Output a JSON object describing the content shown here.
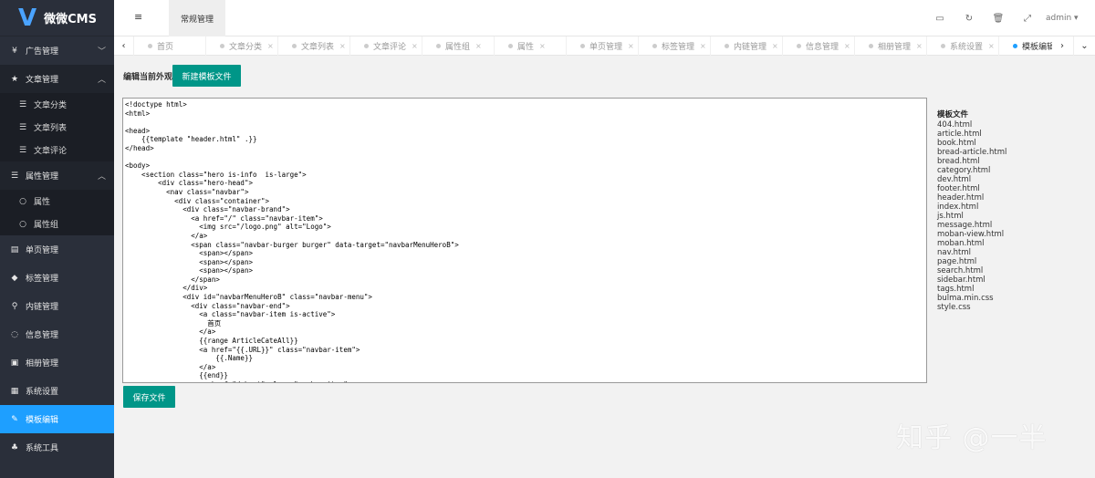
{
  "app": {
    "logo_mark": "V",
    "title": "微微CMS"
  },
  "sidebar": {
    "items": [
      {
        "label": "广告管理",
        "icon": "yen-icon",
        "glyph": "¥",
        "chevron": "﹀"
      },
      {
        "label": "文章管理",
        "icon": "star-icon",
        "glyph": "★",
        "chevron": "︿",
        "children": [
          {
            "label": "文章分类",
            "icon": "list-icon",
            "glyph": "☰"
          },
          {
            "label": "文章列表",
            "icon": "list-icon",
            "glyph": "☰"
          },
          {
            "label": "文章评论",
            "icon": "list-icon",
            "glyph": "☰"
          }
        ]
      },
      {
        "label": "属性管理",
        "icon": "list-icon",
        "glyph": "☰",
        "chevron": "︿",
        "children": [
          {
            "label": "属性",
            "icon": "circle-icon",
            "glyph": "○"
          },
          {
            "label": "属性组",
            "icon": "circle-icon",
            "glyph": "○"
          }
        ]
      },
      {
        "label": "单页管理",
        "icon": "file-icon",
        "glyph": "▤"
      },
      {
        "label": "标签管理",
        "icon": "tag-icon",
        "glyph": "◆"
      },
      {
        "label": "内链管理",
        "icon": "link-icon",
        "glyph": "⚲"
      },
      {
        "label": "信息管理",
        "icon": "comment-icon",
        "glyph": "◌"
      },
      {
        "label": "相册管理",
        "icon": "image-icon",
        "glyph": "▣"
      },
      {
        "label": "系统设置",
        "icon": "windows-icon",
        "glyph": "▦"
      },
      {
        "label": "模板编辑",
        "icon": "edit-icon",
        "glyph": "✎"
      },
      {
        "label": "系统工具",
        "icon": "sitemap-icon",
        "glyph": "♣"
      }
    ]
  },
  "header": {
    "menu_glyph": "≡",
    "tab_label": "常规管理",
    "user": "admin ▾",
    "icons": [
      {
        "name": "monitor-icon",
        "glyph": "▭"
      },
      {
        "name": "refresh-icon",
        "glyph": "↻"
      },
      {
        "name": "trash-icon",
        "glyph": "🗑"
      },
      {
        "name": "fullscreen-icon",
        "glyph": "⤢"
      }
    ]
  },
  "tabs": {
    "prev_glyph": "‹",
    "next_glyph": "›",
    "down_glyph": "⌄",
    "close_glyph": "×",
    "items": [
      {
        "label": "首页",
        "closable": false
      },
      {
        "label": "文章分类",
        "closable": true
      },
      {
        "label": "文章列表",
        "closable": true
      },
      {
        "label": "文章评论",
        "closable": true
      },
      {
        "label": "属性组",
        "closable": true
      },
      {
        "label": "属性",
        "closable": true
      },
      {
        "label": "单页管理",
        "closable": true
      },
      {
        "label": "标签管理",
        "closable": true
      },
      {
        "label": "内链管理",
        "closable": true
      },
      {
        "label": "信息管理",
        "closable": true
      },
      {
        "label": "相册管理",
        "closable": true
      },
      {
        "label": "系统设置",
        "closable": true
      },
      {
        "label": "模板编辑",
        "closable": true,
        "active": true
      }
    ]
  },
  "main": {
    "section_label": "编辑当前外观",
    "new_button": "新建模板文件",
    "save_button": "保存文件",
    "code": "<!doctype html>\n<html>\n\n<head>\n    {{template \"header.html\" .}}\n</head>\n\n<body>\n    <section class=\"hero is-info  is-large\">\n        <div class=\"hero-head\">\n          <nav class=\"navbar\">\n            <div class=\"container\">\n              <div class=\"navbar-brand\">\n                <a href=\"/\" class=\"navbar-item\">\n                  <img src=\"/logo.png\" alt=\"Logo\">\n                </a>\n                <span class=\"navbar-burger burger\" data-target=\"navbarMenuHeroB\">\n                  <span></span>\n                  <span></span>\n                  <span></span>\n                </span>\n              </div>\n              <div id=\"navbarMenuHeroB\" class=\"navbar-menu\">\n                <div class=\"navbar-end\">\n                  <a class=\"navbar-item is-active\">\n                    首页\n                  </a>\n                  {{range ArticleCateAll}}\n                  <a href=\"{{.URL}}\" class=\"navbar-item\">\n                      {{.Name}}\n                  </a>\n                  {{end}}\n                  <a href=\"/about\" class=\"navbar-item\">\n                    关于"
  },
  "files": {
    "title": "模板文件",
    "items": [
      "404.html",
      "article.html",
      "book.html",
      "bread-article.html",
      "bread.html",
      "category.html",
      "dev.html",
      "footer.html",
      "header.html",
      "index.html",
      "js.html",
      "message.html",
      "moban-view.html",
      "moban.html",
      "nav.html",
      "page.html",
      "search.html",
      "sidebar.html",
      "tags.html",
      "bulma.min.css",
      "style.css"
    ]
  },
  "watermark": "知乎 @一半",
  "colors": {
    "sidebar_bg": "#2a2f3a",
    "active_blue": "#1e9fff",
    "button_teal": "#009688"
  }
}
